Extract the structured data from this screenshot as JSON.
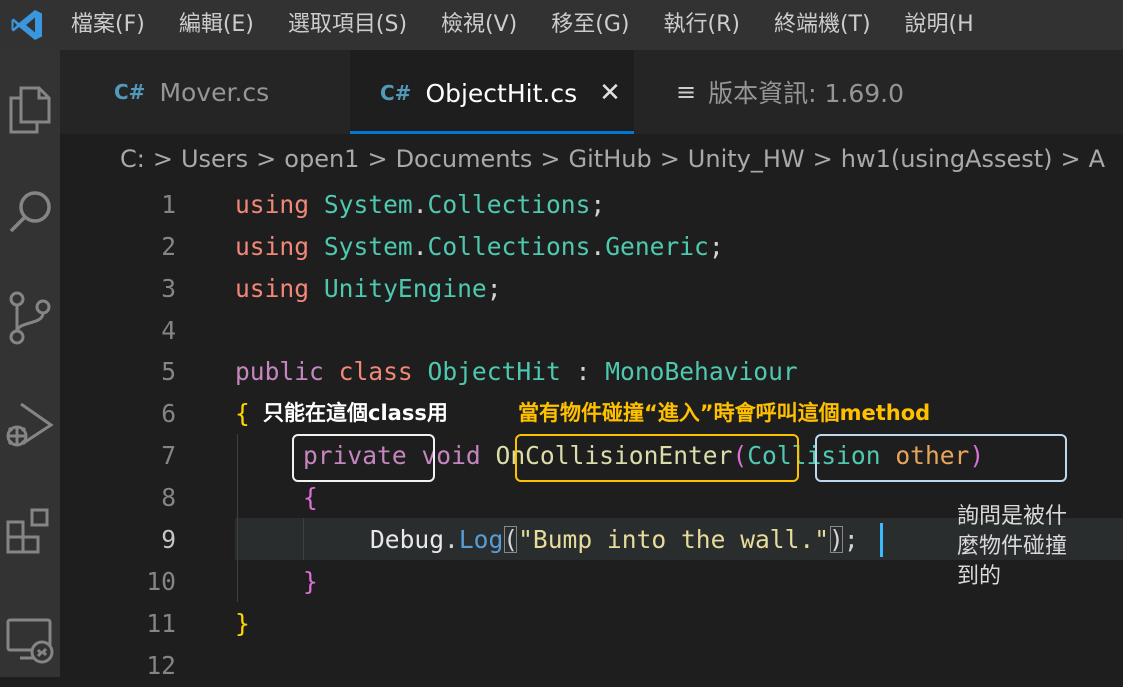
{
  "menu": [
    "檔案(F)",
    "編輯(E)",
    "選取項目(S)",
    "檢視(V)",
    "移至(G)",
    "執行(R)",
    "終端機(T)",
    "說明(H"
  ],
  "tabs": [
    {
      "icon": "C#",
      "label": "Mover.cs"
    },
    {
      "icon": "C#",
      "label": "ObjectHit.cs",
      "close": "✕"
    },
    {
      "icon": "≡",
      "label": "版本資訊: 1.69.0"
    }
  ],
  "breadcrumb": [
    "C:",
    "Users",
    "open1",
    "Documents",
    "GitHub",
    "Unity_HW",
    "hw1(usingAssest)",
    "A"
  ],
  "breadcrumb_sep": ">",
  "line_numbers": [
    "1",
    "2",
    "3",
    "4",
    "5",
    "6",
    "7",
    "8",
    "9",
    "10",
    "11",
    "12"
  ],
  "code": {
    "l1": {
      "kw": "using",
      "ns1": "System",
      "dot": ".",
      "ns2": "Collections",
      "semi": ";"
    },
    "l2": {
      "kw": "using",
      "ns1": "System",
      "dot1": ".",
      "ns2": "Collections",
      "dot2": ".",
      "ns3": "Generic",
      "semi": ";"
    },
    "l3": {
      "kw": "using",
      "ns1": "UnityEngine",
      "semi": ";"
    },
    "l5": {
      "kw1": "public",
      "kw2": "class",
      "name": "ObjectHit",
      "colon": ":",
      "base": "MonoBehaviour"
    },
    "l6": {
      "brace": "{"
    },
    "l7": {
      "mod": "private",
      "ret": "void",
      "fn": "OnCollisionEnter",
      "open": "(",
      "ptype": "Collision",
      "pname": "other",
      "close": ")"
    },
    "l8": {
      "brace": "{"
    },
    "l9": {
      "obj": "Debug",
      "dot": ".",
      "fn": "Log",
      "open": "(",
      "str": "\"Bump into the wall.",
      "strq": "\"",
      "close": ")",
      "semi": ";"
    },
    "l10": {
      "brace": "}"
    },
    "l11": {
      "brace": "}"
    }
  },
  "annotations": {
    "class_note": "只能在這個class用",
    "method_note": "當有物件碰撞“進入”時會呼叫這個method",
    "param_note_line1": "詢問是被什",
    "param_note_line2": "麼物件碰撞",
    "param_note_line3": "到的"
  },
  "colors": {
    "accent": "#0078d4",
    "note_yellow": "#ffc000",
    "note_white": "#ffffff",
    "box_white": "#f2f2f2",
    "box_orange": "#ffc000",
    "box_lightblue": "#bdd7ee"
  }
}
